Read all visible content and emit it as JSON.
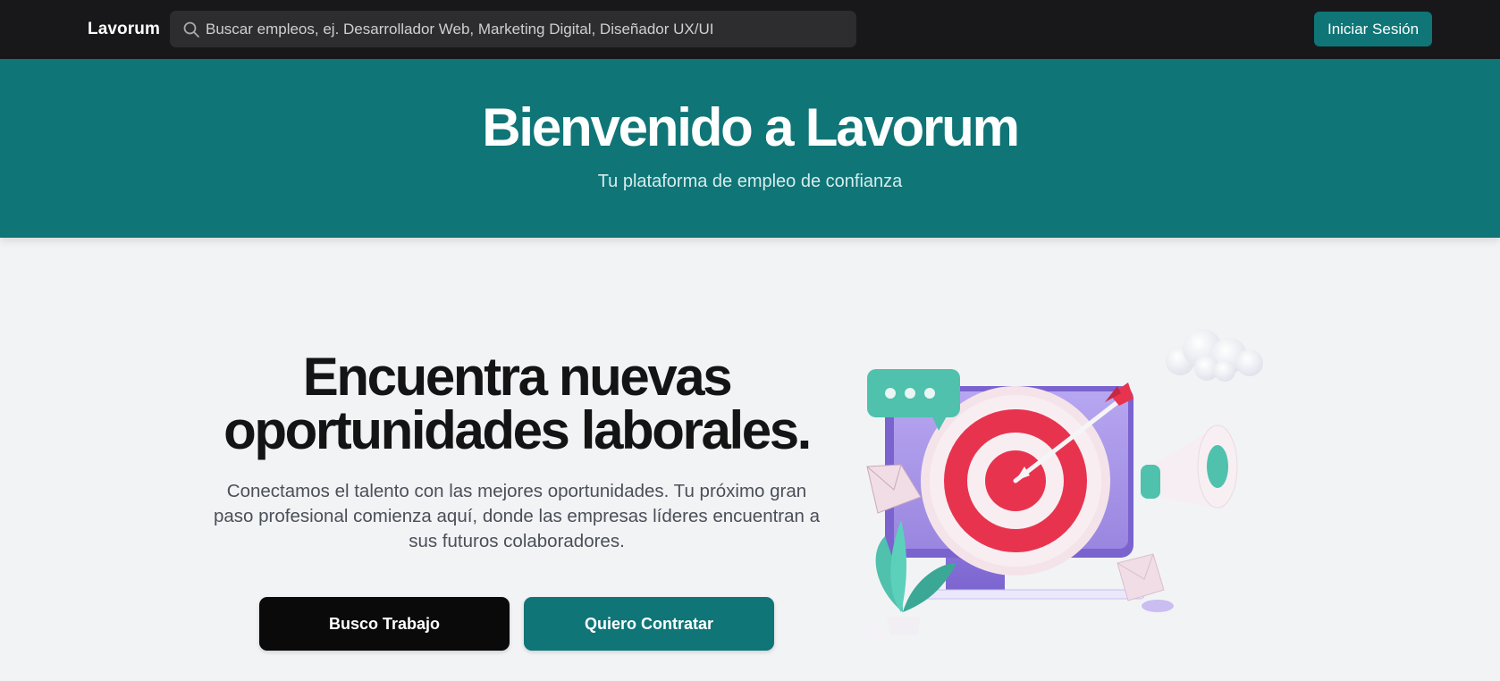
{
  "header": {
    "brand": "Lavorum",
    "search_placeholder": "Buscar empleos, ej. Desarrollador Web, Marketing Digital, Diseñador UX/UI",
    "login_label": "Iniciar Sesión"
  },
  "banner": {
    "title": "Bienvenido a Lavorum",
    "subtitle": "Tu plataforma de empleo de confianza"
  },
  "main": {
    "headline_line1": "Encuentra nuevas",
    "headline_line2": "oportunidades laborales.",
    "description": "Conectamos el talento con las mejores oportunidades. Tu próximo gran paso profesional comienza aquí, donde las empresas líderes encuentran a sus futuros colaboradores.",
    "cta_job_label": "Busco Trabajo",
    "cta_hire_label": "Quiero Contratar"
  },
  "colors": {
    "accent": "#0f7577",
    "topbar": "#18181a",
    "background": "#f2f3f5",
    "target_red": "#e8334f",
    "monitor_purple": "#a895e8"
  },
  "icons": [
    "search-icon"
  ]
}
